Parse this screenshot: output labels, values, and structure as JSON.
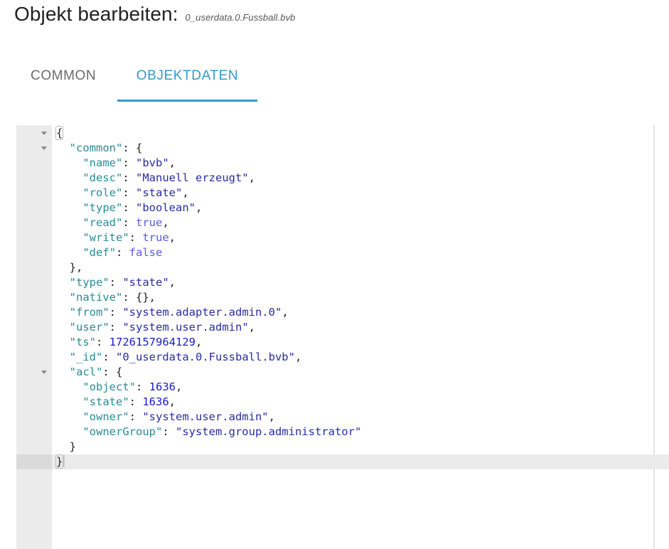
{
  "header": {
    "title": "Objekt bearbeiten:",
    "object_id": "0_userdata.0.Fussball.bvb"
  },
  "tabs": [
    {
      "label": "COMMON",
      "active": false
    },
    {
      "label": "OBJEKTDATEN",
      "active": true
    }
  ],
  "colors": {
    "accent": "#3399cc",
    "json_key": "#2a8c96",
    "json_string": "#2b2ba3",
    "json_number": "#1a1ac8",
    "json_boolean": "#5b5be0"
  },
  "editor": {
    "lines": [
      {
        "indent": 0,
        "fold": true,
        "tokens": [
          {
            "t": "p",
            "v": "{",
            "match": true
          }
        ]
      },
      {
        "indent": 1,
        "fold": true,
        "tokens": [
          {
            "t": "k",
            "v": "\"common\""
          },
          {
            "t": "p",
            "v": ": {"
          }
        ]
      },
      {
        "indent": 2,
        "tokens": [
          {
            "t": "k",
            "v": "\"name\""
          },
          {
            "t": "p",
            "v": ": "
          },
          {
            "t": "s",
            "v": "\"bvb\""
          },
          {
            "t": "p",
            "v": ","
          }
        ]
      },
      {
        "indent": 2,
        "tokens": [
          {
            "t": "k",
            "v": "\"desc\""
          },
          {
            "t": "p",
            "v": ": "
          },
          {
            "t": "s",
            "v": "\"Manuell erzeugt\""
          },
          {
            "t": "p",
            "v": ","
          }
        ]
      },
      {
        "indent": 2,
        "tokens": [
          {
            "t": "k",
            "v": "\"role\""
          },
          {
            "t": "p",
            "v": ": "
          },
          {
            "t": "s",
            "v": "\"state\""
          },
          {
            "t": "p",
            "v": ","
          }
        ]
      },
      {
        "indent": 2,
        "tokens": [
          {
            "t": "k",
            "v": "\"type\""
          },
          {
            "t": "p",
            "v": ": "
          },
          {
            "t": "s",
            "v": "\"boolean\""
          },
          {
            "t": "p",
            "v": ","
          }
        ]
      },
      {
        "indent": 2,
        "tokens": [
          {
            "t": "k",
            "v": "\"read\""
          },
          {
            "t": "p",
            "v": ": "
          },
          {
            "t": "b",
            "v": "true"
          },
          {
            "t": "p",
            "v": ","
          }
        ]
      },
      {
        "indent": 2,
        "tokens": [
          {
            "t": "k",
            "v": "\"write\""
          },
          {
            "t": "p",
            "v": ": "
          },
          {
            "t": "b",
            "v": "true"
          },
          {
            "t": "p",
            "v": ","
          }
        ]
      },
      {
        "indent": 2,
        "tokens": [
          {
            "t": "k",
            "v": "\"def\""
          },
          {
            "t": "p",
            "v": ": "
          },
          {
            "t": "b",
            "v": "false"
          }
        ]
      },
      {
        "indent": 1,
        "tokens": [
          {
            "t": "p",
            "v": "},"
          }
        ]
      },
      {
        "indent": 1,
        "tokens": [
          {
            "t": "k",
            "v": "\"type\""
          },
          {
            "t": "p",
            "v": ": "
          },
          {
            "t": "s",
            "v": "\"state\""
          },
          {
            "t": "p",
            "v": ","
          }
        ]
      },
      {
        "indent": 1,
        "tokens": [
          {
            "t": "k",
            "v": "\"native\""
          },
          {
            "t": "p",
            "v": ": {},"
          }
        ]
      },
      {
        "indent": 1,
        "tokens": [
          {
            "t": "k",
            "v": "\"from\""
          },
          {
            "t": "p",
            "v": ": "
          },
          {
            "t": "s",
            "v": "\"system.adapter.admin.0\""
          },
          {
            "t": "p",
            "v": ","
          }
        ]
      },
      {
        "indent": 1,
        "tokens": [
          {
            "t": "k",
            "v": "\"user\""
          },
          {
            "t": "p",
            "v": ": "
          },
          {
            "t": "s",
            "v": "\"system.user.admin\""
          },
          {
            "t": "p",
            "v": ","
          }
        ]
      },
      {
        "indent": 1,
        "tokens": [
          {
            "t": "k",
            "v": "\"ts\""
          },
          {
            "t": "p",
            "v": ": "
          },
          {
            "t": "n",
            "v": "1726157964129"
          },
          {
            "t": "p",
            "v": ","
          }
        ]
      },
      {
        "indent": 1,
        "tokens": [
          {
            "t": "k",
            "v": "\"_id\""
          },
          {
            "t": "p",
            "v": ": "
          },
          {
            "t": "s",
            "v": "\"0_userdata.0.Fussball.bvb\""
          },
          {
            "t": "p",
            "v": ","
          }
        ]
      },
      {
        "indent": 1,
        "fold": true,
        "tokens": [
          {
            "t": "k",
            "v": "\"acl\""
          },
          {
            "t": "p",
            "v": ": {"
          }
        ]
      },
      {
        "indent": 2,
        "tokens": [
          {
            "t": "k",
            "v": "\"object\""
          },
          {
            "t": "p",
            "v": ": "
          },
          {
            "t": "n",
            "v": "1636"
          },
          {
            "t": "p",
            "v": ","
          }
        ]
      },
      {
        "indent": 2,
        "tokens": [
          {
            "t": "k",
            "v": "\"state\""
          },
          {
            "t": "p",
            "v": ": "
          },
          {
            "t": "n",
            "v": "1636"
          },
          {
            "t": "p",
            "v": ","
          }
        ]
      },
      {
        "indent": 2,
        "tokens": [
          {
            "t": "k",
            "v": "\"owner\""
          },
          {
            "t": "p",
            "v": ": "
          },
          {
            "t": "s",
            "v": "\"system.user.admin\""
          },
          {
            "t": "p",
            "v": ","
          }
        ]
      },
      {
        "indent": 2,
        "tokens": [
          {
            "t": "k",
            "v": "\"ownerGroup\""
          },
          {
            "t": "p",
            "v": ": "
          },
          {
            "t": "s",
            "v": "\"system.group.administrator\""
          }
        ]
      },
      {
        "indent": 1,
        "tokens": [
          {
            "t": "p",
            "v": "}"
          }
        ]
      },
      {
        "indent": 0,
        "active": true,
        "cursor": true,
        "tokens": [
          {
            "t": "p",
            "v": "}",
            "match": true
          }
        ]
      }
    ]
  }
}
